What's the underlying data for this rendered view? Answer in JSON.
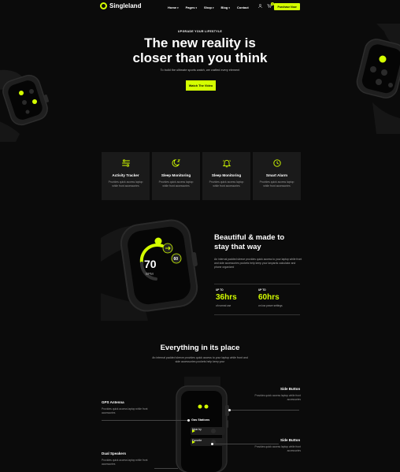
{
  "header": {
    "logo": "Singleland",
    "nav": [
      {
        "label": "Home",
        "caret": "▾",
        "active": true
      },
      {
        "label": "Pages",
        "caret": "▾",
        "active": false
      },
      {
        "label": "Shop",
        "caret": "▾",
        "active": false
      },
      {
        "label": "Blog",
        "caret": "▾",
        "active": false
      },
      {
        "label": "Contact",
        "caret": "",
        "active": false
      }
    ],
    "cart_count": "0",
    "purchase_label": "Purchase Now"
  },
  "hero": {
    "eyebrow": "UPGRADE YOUR LIFESTYLE",
    "title_line1": "The new reality is",
    "title_line2": "closer than you think",
    "subtitle": "To build the ultimate sports watch, we crafted every element",
    "button": "Watch The Video"
  },
  "features": [
    {
      "icon": "activity-tracker-icon",
      "title": "Activity Tracker",
      "desc": "Provides quick access laptop while front accessories"
    },
    {
      "icon": "sleep-monitoring-icon",
      "title": "Sleep Monitoring",
      "desc": "Provides quick access laptop while front accessories"
    },
    {
      "icon": "bell-icon",
      "title": "Sleep Monitoring",
      "desc": "Provides quick access laptop while front accessories"
    },
    {
      "icon": "alarm-clock-icon",
      "title": "Smart Alarm",
      "desc": "Provides quick access laptop while front accessories"
    }
  ],
  "beauty": {
    "title_line1": "Beautiful & made to",
    "title_line2": "stay that way",
    "desc": "An internal padded sleeve provides quick access to your laptop while front and side accessories pockets help keep your lanyards calculator and phone organized",
    "stats": [
      {
        "upto": "UP TO",
        "value": "36hrs",
        "note": "of normal use"
      },
      {
        "upto": "UP TO",
        "value": "60hrs",
        "note": "on low power settings"
      }
    ],
    "watch_reading": "70",
    "watch_unit": "BPM",
    "watch_badge": "60"
  },
  "everything": {
    "title": "Everything in its place",
    "desc": "An internal padded sleeve provides quick access to your laptop while front and side accessories pockets help keep your",
    "specs": [
      {
        "title": "Side Button",
        "desc": "Provides quick access laptop while front accessories"
      },
      {
        "title": "GPS Antenna",
        "desc": "Provides quick access laptop while front accessories"
      },
      {
        "title": "Side Button",
        "desc": "Provides quick access laptop while front accessories"
      },
      {
        "title": "Dual Speakers",
        "desc": "Provides quick access laptop while front accessories"
      }
    ],
    "watch_menu": {
      "header": "Gas Stations",
      "row1": "Near by",
      "row2": "Favorite"
    }
  },
  "colors": {
    "accent": "#d4ff00",
    "background": "#0b0b0b",
    "card": "#1a1a1a"
  }
}
